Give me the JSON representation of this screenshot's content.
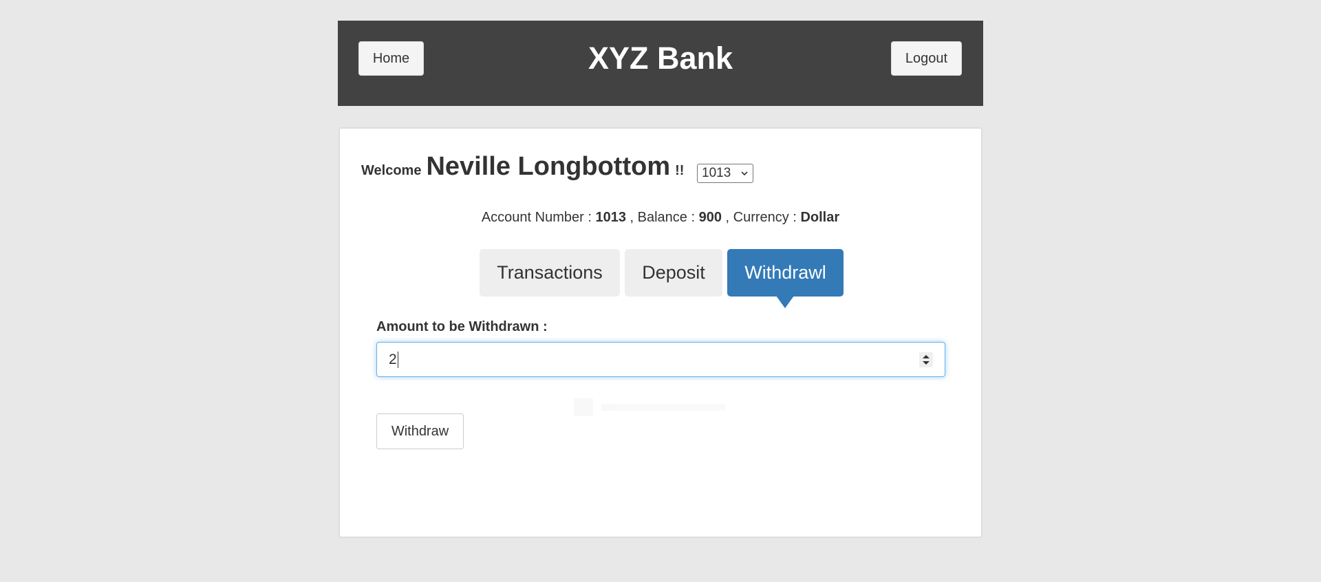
{
  "header": {
    "title": "XYZ Bank",
    "home_label": "Home",
    "logout_label": "Logout"
  },
  "welcome": {
    "label": "Welcome",
    "customer_name": "Neville Longbottom",
    "suffix": "!!",
    "account_select_value": "1013"
  },
  "account_info": {
    "account_number_label": "Account Number :",
    "account_number": "1013",
    "balance_label": ", Balance :",
    "balance": "900",
    "currency_label": ", Currency :",
    "currency": "Dollar"
  },
  "tabs": [
    {
      "label": "Transactions",
      "active": false
    },
    {
      "label": "Deposit",
      "active": false
    },
    {
      "label": "Withdrawl",
      "active": true
    }
  ],
  "withdraw_form": {
    "amount_label": "Amount to be Withdrawn :",
    "amount_value": "2",
    "submit_label": "Withdraw"
  },
  "colors": {
    "header_bg": "#424242",
    "active_tab": "#337ab7",
    "page_bg": "#e8e8e8"
  },
  "icons": {
    "select_arrow": "chevron-down-icon",
    "number_spinner": "spinner-arrows-icon"
  }
}
